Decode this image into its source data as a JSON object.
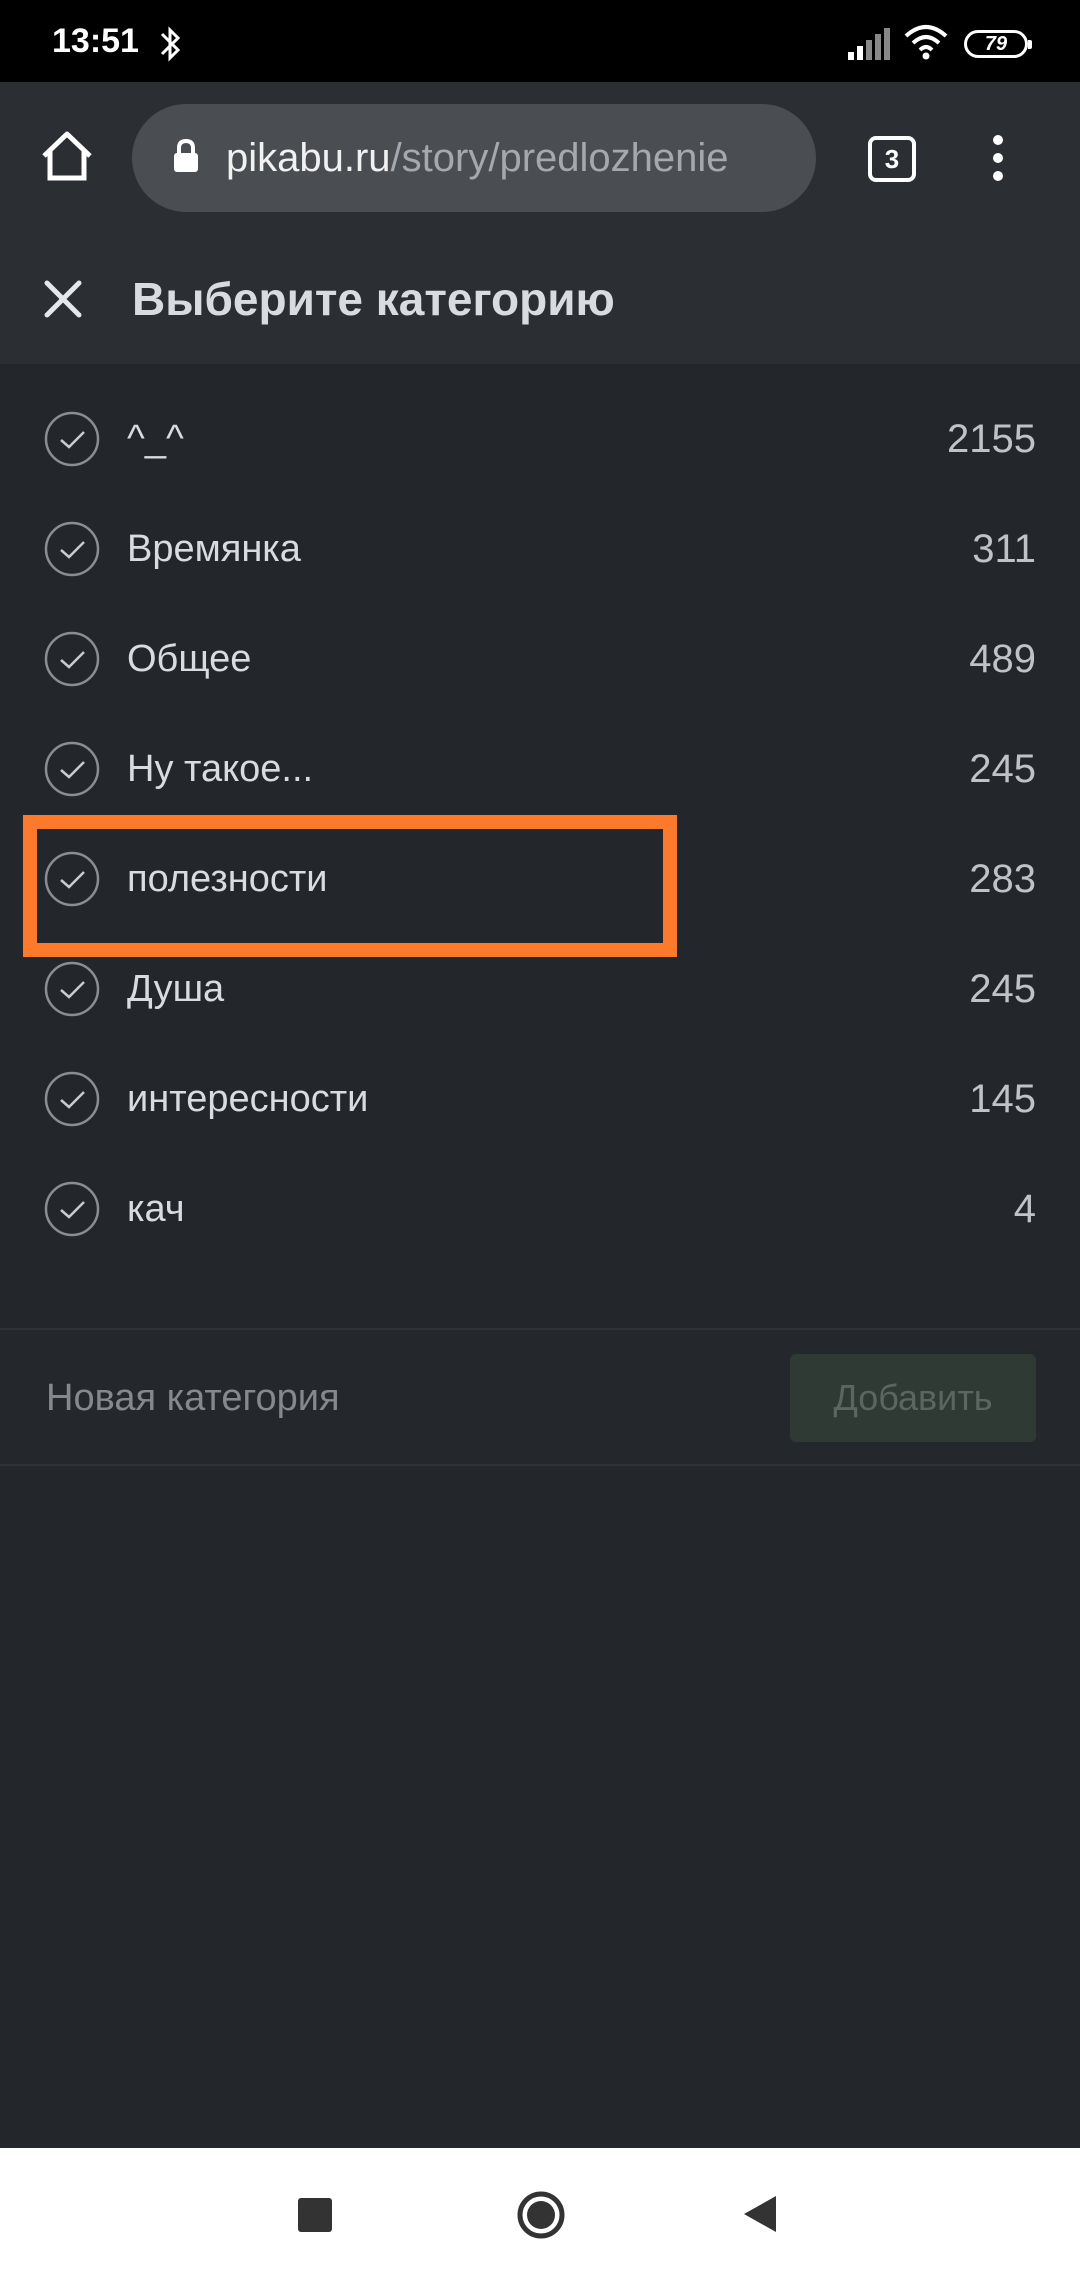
{
  "status_bar": {
    "time": "13:51",
    "battery": "79",
    "icons": [
      "bluetooth-icon",
      "signal-icon",
      "wifi-icon",
      "battery-icon"
    ]
  },
  "browser": {
    "url_domain": "pikabu.ru",
    "url_path": "/story/predlozhenie",
    "tab_count": "3"
  },
  "panel": {
    "title": "Выберите категорию"
  },
  "categories": [
    {
      "name": "^_^",
      "count": "2155"
    },
    {
      "name": "Времянка",
      "count": "311"
    },
    {
      "name": "Общее",
      "count": "489"
    },
    {
      "name": "Ну такое...",
      "count": "245"
    },
    {
      "name": "полезности",
      "count": "283"
    },
    {
      "name": "Душа",
      "count": "245"
    },
    {
      "name": "интересности",
      "count": "145"
    },
    {
      "name": "кач",
      "count": "4"
    }
  ],
  "new_category": {
    "placeholder": "Новая категория",
    "add_label": "Добавить"
  },
  "colors": {
    "background": "#23262a",
    "highlight": "#fd7a2c",
    "button_bg": "#2f3a34"
  }
}
